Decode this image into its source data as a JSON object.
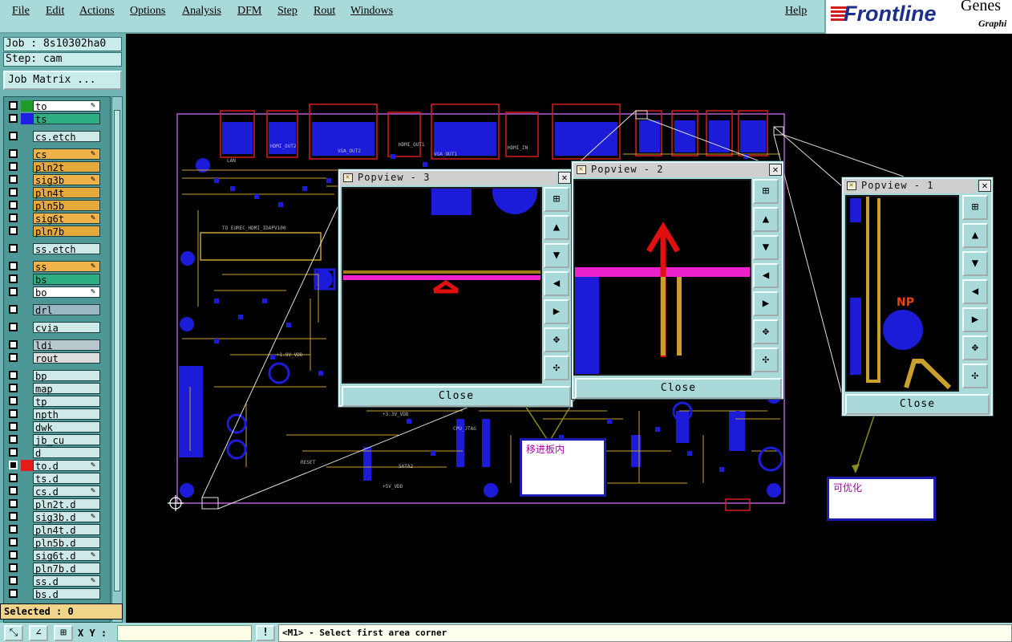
{
  "menubar": {
    "items": [
      "File",
      "Edit",
      "Actions",
      "Options",
      "Analysis",
      "DFM",
      "Step",
      "Rout",
      "Windows"
    ],
    "help": "Help",
    "brand": {
      "logo": "Frontline",
      "product": "Genes",
      "subtitle": "Graphi"
    }
  },
  "panel": {
    "job": "Job : 8s10302ha0",
    "step": "Step: cam",
    "job_matrix": "Job Matrix ...",
    "selected": "Selected : 0"
  },
  "layers": [
    {
      "name": "to",
      "color": "#ffffff",
      "swatch": "#1f9a2a",
      "checked": false,
      "edit": true
    },
    {
      "name": "ts",
      "color": "#2fae84",
      "swatch": "#1f1fe6",
      "checked": false,
      "edit": false
    },
    {
      "name": "cs.etch",
      "color": "#cde9e8",
      "swatch": "",
      "checked": false,
      "edit": false
    },
    {
      "name": "cs",
      "color": "#f0b24a",
      "swatch": "",
      "checked": false,
      "edit": true
    },
    {
      "name": "pln2t",
      "color": "#e7a83b",
      "swatch": "",
      "checked": false,
      "edit": false
    },
    {
      "name": "sig3b",
      "color": "#f0b24a",
      "swatch": "",
      "checked": false,
      "edit": true
    },
    {
      "name": "pln4t",
      "color": "#e7a83b",
      "swatch": "",
      "checked": false,
      "edit": false
    },
    {
      "name": "pln5b",
      "color": "#e7a83b",
      "swatch": "",
      "checked": false,
      "edit": false
    },
    {
      "name": "sig6t",
      "color": "#f0b24a",
      "swatch": "",
      "checked": false,
      "edit": true
    },
    {
      "name": "pln7b",
      "color": "#e7a83b",
      "swatch": "",
      "checked": false,
      "edit": false
    },
    {
      "name": "ss.etch",
      "color": "#cde9e8",
      "swatch": "",
      "checked": false,
      "edit": false
    },
    {
      "name": "ss",
      "color": "#f0b24a",
      "swatch": "",
      "checked": false,
      "edit": true
    },
    {
      "name": "bs",
      "color": "#2fae84",
      "swatch": "",
      "checked": false,
      "edit": false
    },
    {
      "name": "bo",
      "color": "#ffffff",
      "swatch": "",
      "checked": false,
      "edit": true
    },
    {
      "name": "drl",
      "color": "#9bb7c4",
      "swatch": "",
      "checked": false,
      "edit": false
    },
    {
      "name": "cvia",
      "color": "#cde9e8",
      "swatch": "",
      "checked": false,
      "edit": false
    },
    {
      "name": "ldi",
      "color": "#b8c8cc",
      "swatch": "",
      "checked": false,
      "edit": false
    },
    {
      "name": "rout",
      "color": "#dddddd",
      "swatch": "",
      "checked": false,
      "edit": false
    },
    {
      "name": "bp",
      "color": "#cde9e8",
      "swatch": "",
      "checked": false,
      "edit": false
    },
    {
      "name": "map",
      "color": "#cde9e8",
      "swatch": "",
      "checked": false,
      "edit": false
    },
    {
      "name": "tp",
      "color": "#cde9e8",
      "swatch": "",
      "checked": false,
      "edit": false
    },
    {
      "name": "npth",
      "color": "#cde9e8",
      "swatch": "",
      "checked": false,
      "edit": false
    },
    {
      "name": "dwk",
      "color": "#cde9e8",
      "swatch": "",
      "checked": false,
      "edit": false
    },
    {
      "name": "jb_cu",
      "color": "#cde9e8",
      "swatch": "",
      "checked": false,
      "edit": false
    },
    {
      "name": "d",
      "color": "#cde9e8",
      "swatch": "",
      "checked": false,
      "edit": false
    },
    {
      "name": "to.d",
      "color": "#cde9e8",
      "swatch": "#e21b1b",
      "checked": true,
      "edit": true
    },
    {
      "name": "ts.d",
      "color": "#cde9e8",
      "swatch": "",
      "checked": false,
      "edit": false
    },
    {
      "name": "cs.d",
      "color": "#cde9e8",
      "swatch": "",
      "checked": false,
      "edit": true
    },
    {
      "name": "pln2t.d",
      "color": "#cde9e8",
      "swatch": "",
      "checked": false,
      "edit": false
    },
    {
      "name": "sig3b.d",
      "color": "#cde9e8",
      "swatch": "",
      "checked": false,
      "edit": true
    },
    {
      "name": "pln4t.d",
      "color": "#cde9e8",
      "swatch": "",
      "checked": false,
      "edit": false
    },
    {
      "name": "pln5b.d",
      "color": "#cde9e8",
      "swatch": "",
      "checked": false,
      "edit": false
    },
    {
      "name": "sig6t.d",
      "color": "#cde9e8",
      "swatch": "",
      "checked": false,
      "edit": true
    },
    {
      "name": "pln7b.d",
      "color": "#cde9e8",
      "swatch": "",
      "checked": false,
      "edit": false
    },
    {
      "name": "ss.d",
      "color": "#cde9e8",
      "swatch": "",
      "checked": false,
      "edit": true
    },
    {
      "name": "bs.d",
      "color": "#cde9e8",
      "swatch": "",
      "checked": false,
      "edit": false
    }
  ],
  "board": {
    "labels": [
      "HDMI_OUT2",
      "VGA_OUT2",
      "HDMI_OUT1",
      "VGA_OUT1",
      "HDMI_IN",
      "LAN",
      "TO EUREC_HDMI_IDAPV100",
      "+1.8V_VDD",
      "+3.3V_VDD",
      "CPU_JTAG",
      "+5V_VDD",
      "RESET",
      "SATA2"
    ]
  },
  "popviews": {
    "p1": {
      "title": "Popview - 1",
      "close": "Close",
      "np_label": "NP"
    },
    "p2": {
      "title": "Popview - 2",
      "close": "Close"
    },
    "p3": {
      "title": "Popview - 3",
      "close": "Close"
    }
  },
  "notes": {
    "note_a": "移进板内",
    "note_b": "可优化"
  },
  "toolbar_icons": [
    "zoom-area-icon",
    "measure-icon",
    "snap-grid-icon",
    "alert-icon"
  ],
  "bottombar": {
    "xy_label": "X Y :",
    "xy_value": "",
    "status": "<M1> - Select first area corner",
    "alert": "!"
  }
}
